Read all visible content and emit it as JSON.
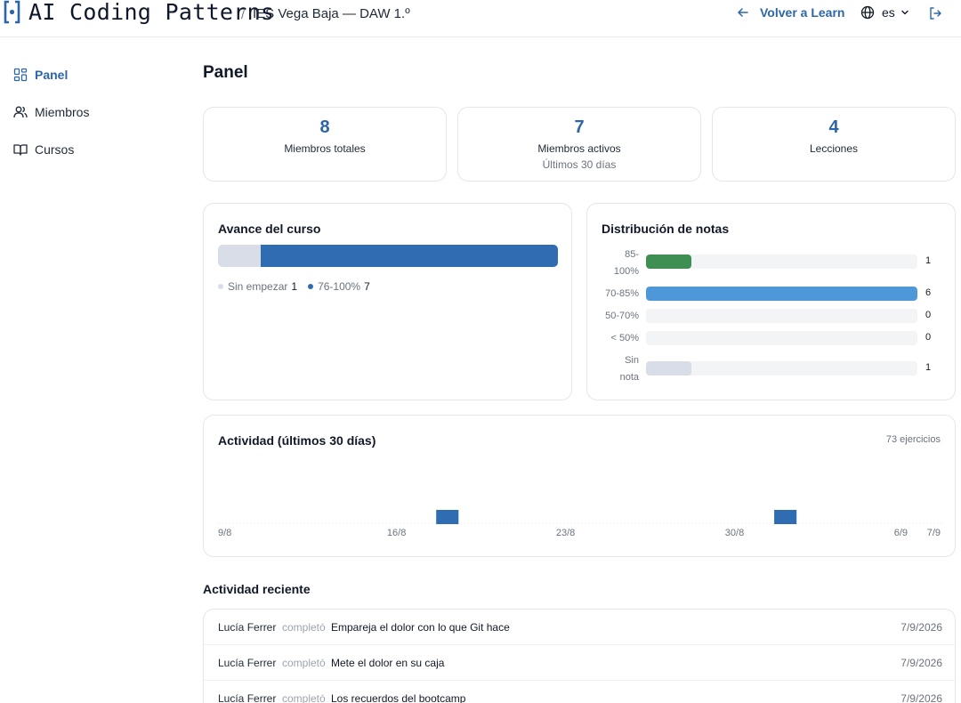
{
  "header": {
    "app_title": "AI Coding Patterns",
    "breadcrumb_separator": "/",
    "breadcrumb": "IES Vega Baja — DAW 1.º",
    "back_link": "Volver a Learn",
    "language": "es"
  },
  "icons": {
    "logo": "bracketed-dot-logo",
    "back": "arrow-left-icon",
    "language": "globe-icon",
    "language_dropdown": "chevron-down-icon",
    "logout": "logout-icon"
  },
  "sidebar": {
    "items": [
      {
        "label": "Panel",
        "icon": "dashboard-grid-icon",
        "active": true
      },
      {
        "label": "Miembros",
        "icon": "users-icon",
        "active": false
      },
      {
        "label": "Cursos",
        "icon": "book-open-icon",
        "active": false
      }
    ]
  },
  "main": {
    "title": "Panel",
    "stats": [
      {
        "value": "8",
        "label": "Miembros totales",
        "sub": ""
      },
      {
        "value": "7",
        "label": "Miembros activos",
        "sub": "Últimos 30 días"
      },
      {
        "value": "4",
        "label": "Lecciones",
        "sub": ""
      }
    ],
    "progress": {
      "title": "Avance del curso",
      "segments": [
        {
          "label": "Sin empezar",
          "count": "1",
          "value": 1,
          "color": "#d9dde8"
        },
        {
          "label": "76-100%",
          "count": "7",
          "value": 7,
          "color": "#2f6cb1"
        }
      ]
    },
    "grades": {
      "title": "Distribución de notas",
      "max": 6,
      "rows": [
        {
          "label": "85-100%",
          "count": "1",
          "value": 1,
          "color": "#3f8f52"
        },
        {
          "label": "70-85%",
          "count": "6",
          "value": 6,
          "color": "#4e98d9"
        },
        {
          "label": "50-70%",
          "count": "0",
          "value": 0,
          "color": "#4e98d9"
        },
        {
          "label": "< 50%",
          "count": "0",
          "value": 0,
          "color": "#4e98d9"
        },
        {
          "label": "Sin nota",
          "count": "1",
          "value": 1,
          "color": "#d9dde8"
        }
      ]
    },
    "activity": {
      "title": "Actividad (últimos 30 días)",
      "total": "73 ejercicios"
    },
    "recent": {
      "title": "Actividad reciente",
      "items": [
        {
          "name": "Lucía Ferrer",
          "verb": "completó",
          "lesson": "Empareja el dolor con lo que Git hace",
          "date": "7/9/2026"
        },
        {
          "name": "Lucía Ferrer",
          "verb": "completó",
          "lesson": "Mete el dolor en su caja",
          "date": "7/9/2026"
        },
        {
          "name": "Lucía Ferrer",
          "verb": "completó",
          "lesson": "Los recuerdos del bootcamp",
          "date": "7/9/2026"
        }
      ]
    }
  },
  "chart_data": {
    "type": "bar",
    "title": "Actividad (últimos 30 días)",
    "xlabel": "",
    "ylabel": "",
    "x_ticks": [
      "9/8",
      "16/8",
      "23/8",
      "30/8",
      "6/9",
      "7/9"
    ],
    "categories": [
      "9/8",
      "10/8",
      "11/8",
      "12/8",
      "13/8",
      "14/8",
      "15/8",
      "16/8",
      "17/8",
      "18/8",
      "19/8",
      "20/8",
      "21/8",
      "22/8",
      "23/8",
      "24/8",
      "25/8",
      "26/8",
      "27/8",
      "28/8",
      "29/8",
      "30/8",
      "31/8",
      "1/9",
      "2/9",
      "3/9",
      "4/9",
      "5/9",
      "6/9",
      "7/9"
    ],
    "values": [
      0,
      0,
      0,
      0,
      0,
      0,
      0,
      0,
      0,
      2,
      0,
      0,
      0,
      0,
      0,
      0,
      0,
      0,
      0,
      0,
      0,
      0,
      0,
      2,
      0,
      0,
      0,
      0,
      0,
      0
    ],
    "ylim": [
      0,
      10
    ],
    "color": "#2f6cb1",
    "grid": false
  }
}
